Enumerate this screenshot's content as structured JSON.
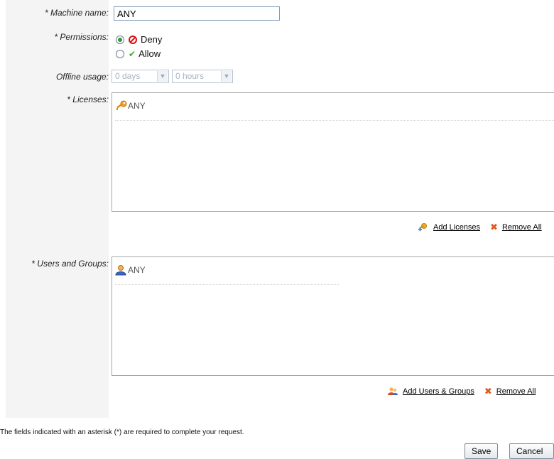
{
  "form": {
    "machine_name": {
      "label": "* Machine name:",
      "value": "ANY"
    },
    "permissions": {
      "label": "* Permissions:",
      "options": [
        {
          "label": "Deny",
          "selected": true,
          "icon": "deny-icon"
        },
        {
          "label": "Allow",
          "selected": false,
          "icon": "check-icon"
        }
      ]
    },
    "offline_usage": {
      "label": "Offline usage:",
      "days": "0 days",
      "hours": "0 hours"
    },
    "licenses": {
      "label": "* Licenses:",
      "items": [
        {
          "text": "ANY",
          "icon": "key-icon"
        }
      ],
      "add_label": "Add Licenses",
      "remove_all_label": "Remove All"
    },
    "users_groups": {
      "label": "* Users and Groups:",
      "items": [
        {
          "text": "ANY",
          "icon": "user-icon"
        }
      ],
      "add_label": "Add Users & Groups",
      "remove_all_label": "Remove All"
    }
  },
  "note": "The fields indicated with an asterisk (*) are required to complete your request.",
  "buttons": {
    "save": "Save",
    "cancel": "Cancel"
  },
  "colors": {
    "label_bg": "#f4f4f4",
    "checked_radio": "#2b9a38",
    "deny": "#dd1111",
    "allow": "#3caa2a"
  }
}
